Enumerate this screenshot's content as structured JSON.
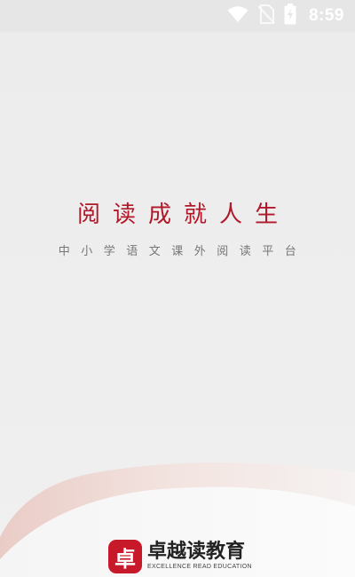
{
  "status_bar": {
    "time": "8:59",
    "icons": [
      "wifi-icon",
      "no-sim-icon",
      "battery-charging-icon"
    ]
  },
  "splash": {
    "slogan": "阅读成就人生",
    "subtitle": "中小学语文课外阅读平台"
  },
  "brand": {
    "logo_glyph": "卓",
    "name": "卓越读教育",
    "tagline": "EXCELLENCE READ EDUCATION"
  },
  "colors": {
    "accent": "#c8192b",
    "slogan": "#b0182a",
    "background": "#ececec"
  }
}
